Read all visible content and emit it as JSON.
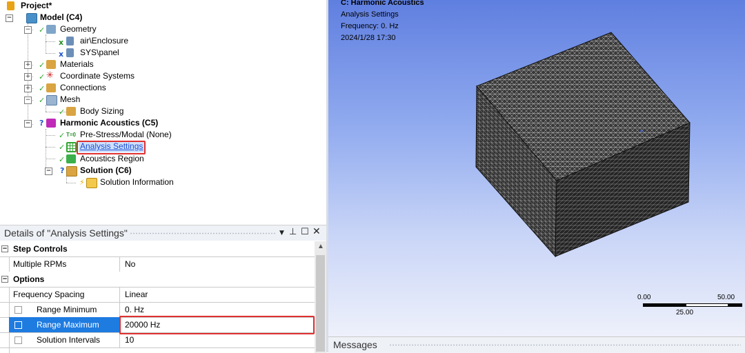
{
  "tree": {
    "project": "Project*",
    "model": "Model (C4)",
    "geometry": "Geometry",
    "body1": "air\\Enclosure",
    "body2": "SYS\\panel",
    "materials": "Materials",
    "coord": "Coordinate Systems",
    "connections": "Connections",
    "mesh": "Mesh",
    "body_sizing": "Body Sizing",
    "harmonic": "Harmonic Acoustics (C5)",
    "prestress": "Pre-Stress/Modal (None)",
    "prestress_icon_text": "T=0",
    "analysis_settings": "Analysis Settings",
    "acoustics_region": "Acoustics Region",
    "solution": "Solution (C6)",
    "solution_info": "Solution Information"
  },
  "details": {
    "title": "Details of \"Analysis Settings\"",
    "rows": [
      {
        "category": true,
        "name": "Step Controls"
      },
      {
        "name": "Multiple RPMs",
        "value": "No"
      },
      {
        "category": true,
        "name": "Options"
      },
      {
        "name": "Frequency Spacing",
        "value": "Linear"
      },
      {
        "name": "Range Minimum",
        "value": "0. Hz",
        "checkbox": true
      },
      {
        "name": "Range Maximum",
        "value": "20000 Hz",
        "checkbox": true,
        "highlight": true
      },
      {
        "name": "Solution Intervals",
        "value": "10",
        "checkbox": true
      }
    ]
  },
  "view": {
    "title": "C: Harmonic Acoustics",
    "subtitle": "Analysis Settings",
    "frequency": "Frequency: 0. Hz",
    "timestamp": "2024/1/28 17:30",
    "scale_left": "0.00",
    "scale_right": "50.00",
    "scale_mid": "25.00"
  },
  "messages": {
    "title": "Messages"
  },
  "colors": {
    "selection": "#1e7be0",
    "highlight_border": "#e03030",
    "viewport_top": "#5f7fe0"
  }
}
